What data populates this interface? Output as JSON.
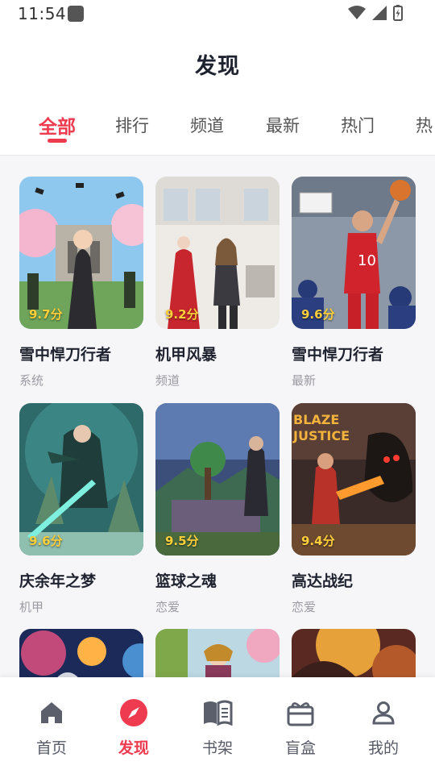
{
  "status": {
    "time": "11:54"
  },
  "header": {
    "title": "发现"
  },
  "tabs": [
    {
      "label": "全部",
      "active": true
    },
    {
      "label": "排行"
    },
    {
      "label": "频道"
    },
    {
      "label": "最新"
    },
    {
      "label": "热门"
    },
    {
      "label": "热"
    }
  ],
  "books": [
    {
      "title": "雪中悍刀行者",
      "tag": "系统",
      "score": "9.7分"
    },
    {
      "title": "机甲风暴",
      "tag": "频道",
      "score": "9.2分"
    },
    {
      "title": "雪中悍刀行者",
      "tag": "最新",
      "score": "9.6分"
    },
    {
      "title": "庆余年之梦",
      "tag": "机甲",
      "score": "9.6分"
    },
    {
      "title": "篮球之魂",
      "tag": "恋爱",
      "score": "9.5分"
    },
    {
      "title": "高达战纪",
      "tag": "恋爱",
      "score": "9.4分"
    },
    {
      "title": "",
      "tag": "",
      "score": ""
    },
    {
      "title": "",
      "tag": "",
      "score": ""
    },
    {
      "title": "",
      "tag": "",
      "score": ""
    }
  ],
  "bottom_nav": [
    {
      "label": "首页",
      "icon": "home-icon"
    },
    {
      "label": "发现",
      "icon": "compass-icon",
      "active": true
    },
    {
      "label": "书架",
      "icon": "book-icon"
    },
    {
      "label": "盲盒",
      "icon": "gift-box-icon"
    },
    {
      "label": "我的",
      "icon": "user-icon"
    }
  ],
  "colors": {
    "accent": "#ef3b4f",
    "score": "#ffcf3a",
    "background": "#f6f6f8"
  }
}
